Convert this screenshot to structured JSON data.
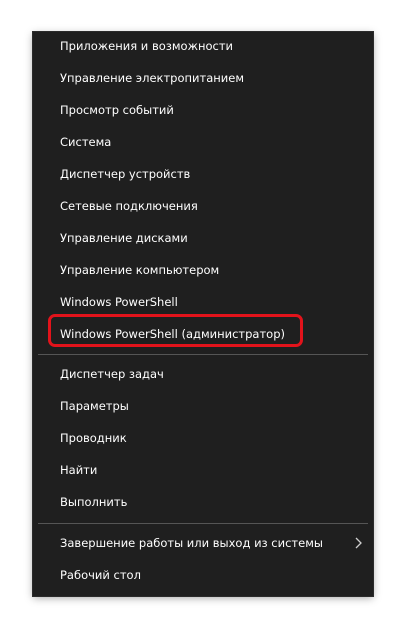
{
  "menu": {
    "group1": [
      {
        "label": "Приложения и возможности"
      },
      {
        "label": "Управление электропитанием"
      },
      {
        "label": "Просмотр событий"
      },
      {
        "label": "Система"
      },
      {
        "label": "Диспетчер устройств"
      },
      {
        "label": "Сетевые подключения"
      },
      {
        "label": "Управление дисками"
      },
      {
        "label": "Управление компьютером"
      },
      {
        "label": "Windows PowerShell"
      },
      {
        "label": "Windows PowerShell (администратор)"
      }
    ],
    "group2": [
      {
        "label": "Диспетчер задач"
      },
      {
        "label": "Параметры"
      },
      {
        "label": "Проводник"
      },
      {
        "label": "Найти"
      },
      {
        "label": "Выполнить"
      }
    ],
    "group3": [
      {
        "label": "Завершение работы или выход из системы",
        "icon": "chevron-right-icon"
      },
      {
        "label": "Рабочий стол"
      }
    ]
  },
  "colors": {
    "menu_background": "#1f1f1f",
    "text": "#ffffff",
    "separator": "#555555",
    "highlight_border": "#e2131b"
  }
}
